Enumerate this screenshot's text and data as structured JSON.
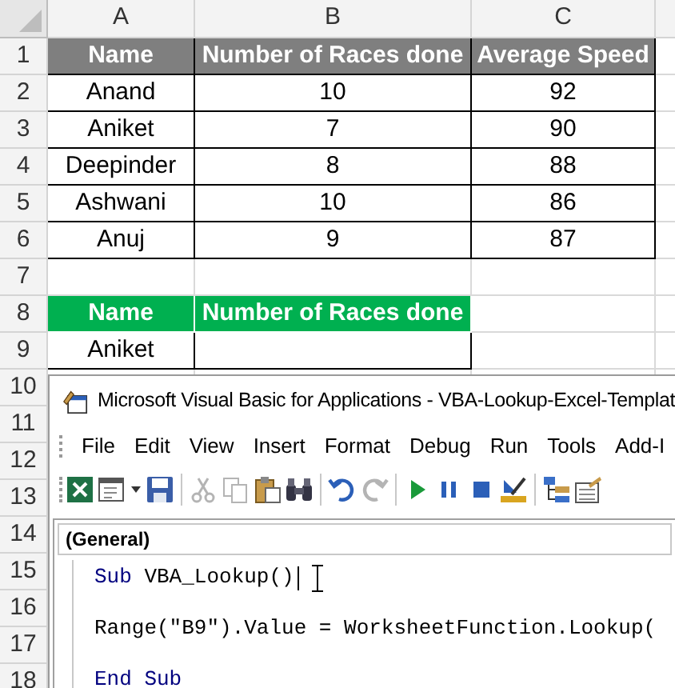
{
  "sheet": {
    "columns": [
      "A",
      "B",
      "C"
    ],
    "rows": [
      {
        "number": "1",
        "kind": "header-gray",
        "cells": [
          "Name",
          "Number of Races done",
          "Average Speed"
        ]
      },
      {
        "number": "2",
        "kind": "data",
        "cells": [
          "Anand",
          "10",
          "92"
        ]
      },
      {
        "number": "3",
        "kind": "data",
        "cells": [
          "Aniket",
          "7",
          "90"
        ]
      },
      {
        "number": "4",
        "kind": "data",
        "cells": [
          "Deepinder",
          "8",
          "88"
        ]
      },
      {
        "number": "5",
        "kind": "data",
        "cells": [
          "Ashwani",
          "10",
          "86"
        ]
      },
      {
        "number": "6",
        "kind": "data",
        "cells": [
          "Anuj",
          "9",
          "87"
        ]
      },
      {
        "number": "7",
        "kind": "empty",
        "cells": []
      },
      {
        "number": "8",
        "kind": "header-green",
        "cells": [
          "Name",
          "Number of Races done"
        ]
      },
      {
        "number": "9",
        "kind": "lookup",
        "cells": [
          "Aniket"
        ]
      },
      {
        "number": "10",
        "kind": "covered",
        "cells": []
      },
      {
        "number": "11",
        "kind": "covered",
        "cells": []
      },
      {
        "number": "12",
        "kind": "covered",
        "cells": []
      },
      {
        "number": "13",
        "kind": "covered",
        "cells": []
      },
      {
        "number": "14",
        "kind": "covered",
        "cells": []
      },
      {
        "number": "15",
        "kind": "covered",
        "cells": []
      },
      {
        "number": "16",
        "kind": "covered",
        "cells": []
      },
      {
        "number": "17",
        "kind": "covered",
        "cells": []
      },
      {
        "number": "18",
        "kind": "covered",
        "cells": []
      }
    ]
  },
  "vba_window": {
    "title": "Microsoft Visual Basic for Applications - VBA-Lookup-Excel-Templat",
    "menu": [
      "File",
      "Edit",
      "View",
      "Insert",
      "Format",
      "Debug",
      "Run",
      "Tools",
      "Add-I"
    ],
    "toolbar": [
      {
        "kind": "excel",
        "disabled": false
      },
      {
        "kind": "userform",
        "disabled": false
      },
      {
        "kind": "dropdown",
        "disabled": false
      },
      {
        "kind": "save",
        "disabled": false
      },
      {
        "kind": "separator"
      },
      {
        "kind": "cut",
        "disabled": true
      },
      {
        "kind": "copy",
        "disabled": true
      },
      {
        "kind": "paste",
        "disabled": false
      },
      {
        "kind": "find",
        "disabled": false
      },
      {
        "kind": "separator"
      },
      {
        "kind": "undo",
        "disabled": false
      },
      {
        "kind": "redo",
        "disabled": true
      },
      {
        "kind": "separator"
      },
      {
        "kind": "run",
        "disabled": false
      },
      {
        "kind": "pause",
        "disabled": false
      },
      {
        "kind": "stop",
        "disabled": false
      },
      {
        "kind": "design",
        "disabled": false
      },
      {
        "kind": "separator"
      },
      {
        "kind": "explorer",
        "disabled": false
      },
      {
        "kind": "properties",
        "disabled": false
      }
    ],
    "object_box": "(General)",
    "code": [
      [
        {
          "text": "Sub",
          "kind": "keyword"
        },
        {
          "text": " VBA_Lookup()",
          "kind": "plain"
        }
      ],
      [
        {
          "text": "Range(\"B9\").Value = WorksheetFunction.Lookup(",
          "kind": "plain"
        }
      ],
      [
        {
          "text": "End Sub",
          "kind": "keyword"
        }
      ]
    ]
  }
}
